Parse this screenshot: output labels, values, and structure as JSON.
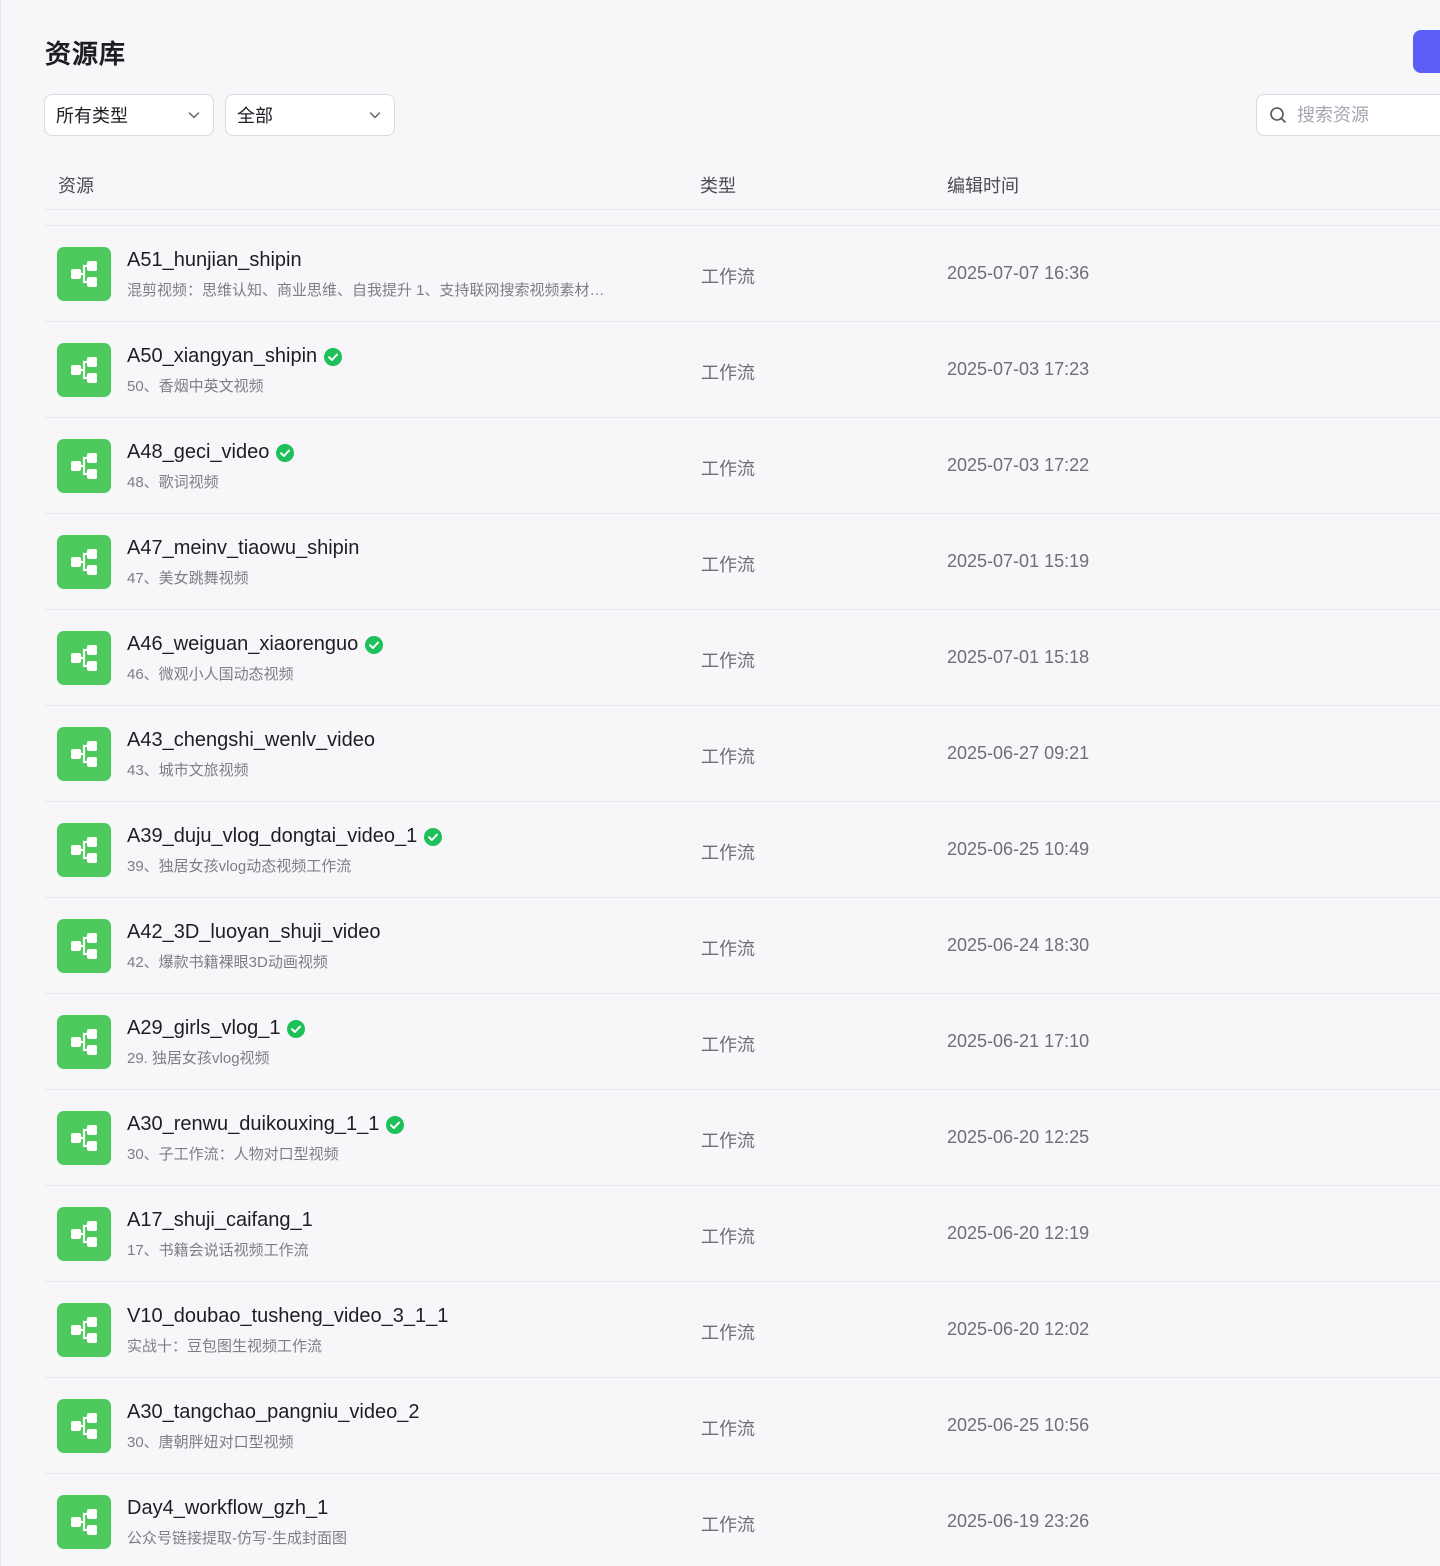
{
  "header": {
    "title": "资源库"
  },
  "filters": {
    "type_select": "所有类型",
    "scope_select": "全部",
    "search_placeholder": "搜索资源"
  },
  "table": {
    "columns": {
      "resource": "资源",
      "type": "类型",
      "edit_time": "编辑时间"
    },
    "rows": [
      {
        "name": "A51_hunjian_shipin",
        "verified": false,
        "desc": "混剪视频：思维认知、商业思维、自我提升 1、支持联网搜索视频素材…",
        "type": "工作流",
        "time": "2025-07-07 16:36"
      },
      {
        "name": "A50_xiangyan_shipin",
        "verified": true,
        "desc": "50、香烟中英文视频",
        "type": "工作流",
        "time": "2025-07-03 17:23"
      },
      {
        "name": "A48_geci_video",
        "verified": true,
        "desc": "48、歌词视频",
        "type": "工作流",
        "time": "2025-07-03 17:22"
      },
      {
        "name": "A47_meinv_tiaowu_shipin",
        "verified": false,
        "desc": "47、美女跳舞视频",
        "type": "工作流",
        "time": "2025-07-01 15:19"
      },
      {
        "name": "A46_weiguan_xiaorenguo",
        "verified": true,
        "desc": "46、微观小人国动态视频",
        "type": "工作流",
        "time": "2025-07-01 15:18"
      },
      {
        "name": "A43_chengshi_wenlv_video",
        "verified": false,
        "desc": "43、城市文旅视频",
        "type": "工作流",
        "time": "2025-06-27 09:21"
      },
      {
        "name": "A39_duju_vlog_dongtai_video_1",
        "verified": true,
        "desc": "39、独居女孩vlog动态视频工作流",
        "type": "工作流",
        "time": "2025-06-25 10:49"
      },
      {
        "name": "A42_3D_luoyan_shuji_video",
        "verified": false,
        "desc": "42、爆款书籍裸眼3D动画视频",
        "type": "工作流",
        "time": "2025-06-24 18:30"
      },
      {
        "name": "A29_girls_vlog_1",
        "verified": true,
        "desc": "29. 独居女孩vlog视频",
        "type": "工作流",
        "time": "2025-06-21 17:10"
      },
      {
        "name": "A30_renwu_duikouxing_1_1",
        "verified": true,
        "desc": "30、子工作流：人物对口型视频",
        "type": "工作流",
        "time": "2025-06-20 12:25"
      },
      {
        "name": "A17_shuji_caifang_1",
        "verified": false,
        "desc": "17、书籍会说话视频工作流",
        "type": "工作流",
        "time": "2025-06-20 12:19"
      },
      {
        "name": "V10_doubao_tusheng_video_3_1_1",
        "verified": false,
        "desc": "实战十：豆包图生视频工作流",
        "type": "工作流",
        "time": "2025-06-20 12:02"
      },
      {
        "name": "A30_tangchao_pangniu_video_2",
        "verified": false,
        "desc": "30、唐朝胖妞对口型视频",
        "type": "工作流",
        "time": "2025-06-25 10:56"
      },
      {
        "name": "Day4_workflow_gzh_1",
        "verified": false,
        "desc": "公众号链接提取-仿写-生成封面图",
        "type": "工作流",
        "time": "2025-06-19 23:26"
      }
    ]
  },
  "colors": {
    "accent": "#5b5ef6",
    "workflow_icon": "#4ec95b",
    "verified": "#1ec05a"
  },
  "icons": {
    "row_icon": "workflow-icon",
    "verified": "verified-check-icon",
    "search": "search-icon",
    "dropdown": "chevron-down-icon"
  }
}
